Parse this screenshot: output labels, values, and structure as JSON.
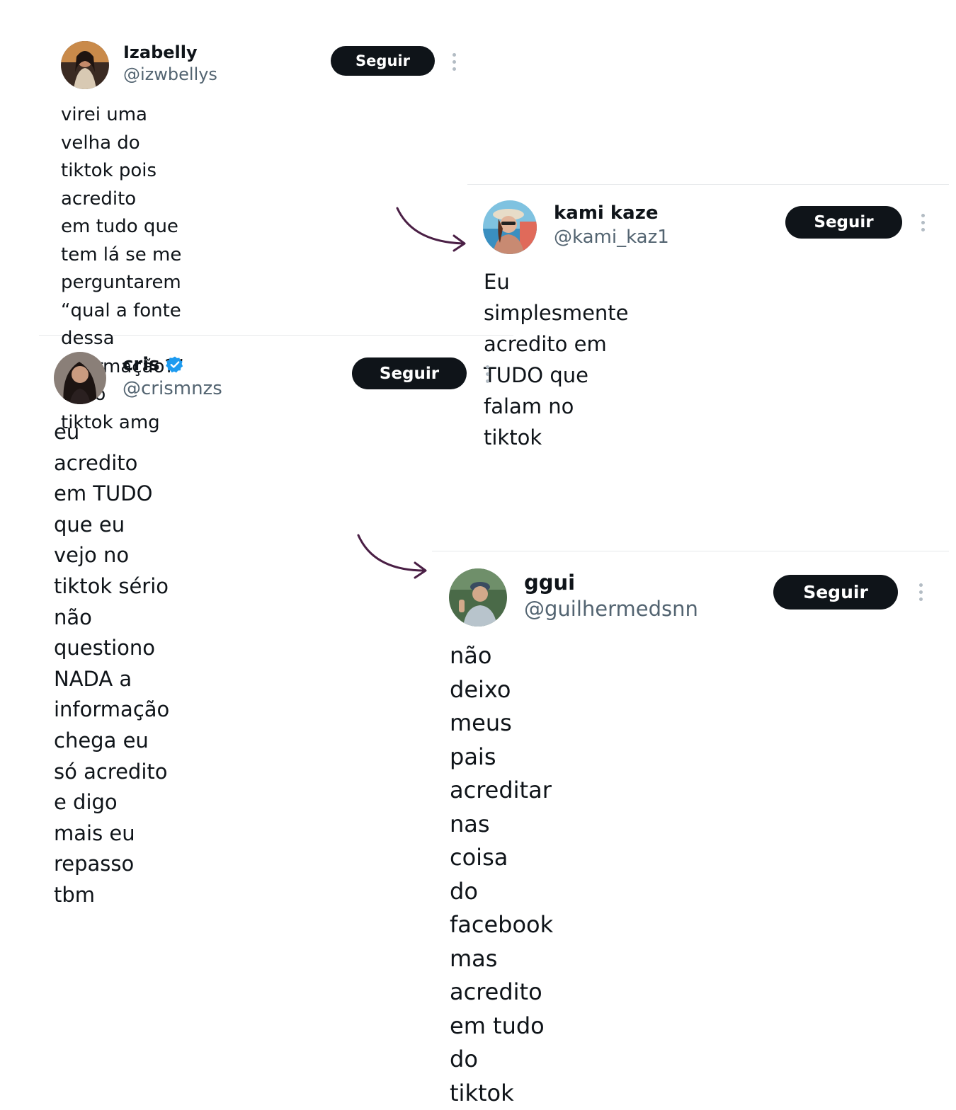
{
  "colors": {
    "text": "#0f1419",
    "handle": "#536471",
    "button_bg": "#0f1419",
    "button_text": "#ffffff",
    "verified": "#1d9bf0",
    "arrow": "#4a1f45"
  },
  "tweets": [
    {
      "name": "Izabelly",
      "handle": "@izwbellys",
      "follow_label": "Seguir",
      "verified": false,
      "text": "virei uma velha do tiktok pois acredito\nem tudo que tem lá se me perguntarem\n“qual a fonte dessa informação?” vi no\ntiktok amg",
      "avatar_icon": "avatar-photo"
    },
    {
      "name": "kami kaze",
      "handle": "@kami_kaz1",
      "follow_label": "Seguir",
      "verified": false,
      "text": "Eu simplesmente acredito em TUDO que\nfalam no tiktok",
      "avatar_icon": "avatar-photo"
    },
    {
      "name": "cris",
      "handle": "@crismnzs",
      "follow_label": "Seguir",
      "verified": true,
      "text": "eu acredito em TUDO que eu vejo no\ntiktok sério não questiono NADA a\ninformação chega eu só acredito e digo\nmais eu repasso tbm",
      "avatar_icon": "avatar-photo"
    },
    {
      "name": "ggui",
      "handle": "@guilhermedsnn",
      "follow_label": "Seguir",
      "verified": false,
      "text": "não deixo meus pais acreditar nas coisa\ndo facebook mas acredito em tudo do\ntiktok",
      "avatar_icon": "avatar-photo"
    }
  ]
}
